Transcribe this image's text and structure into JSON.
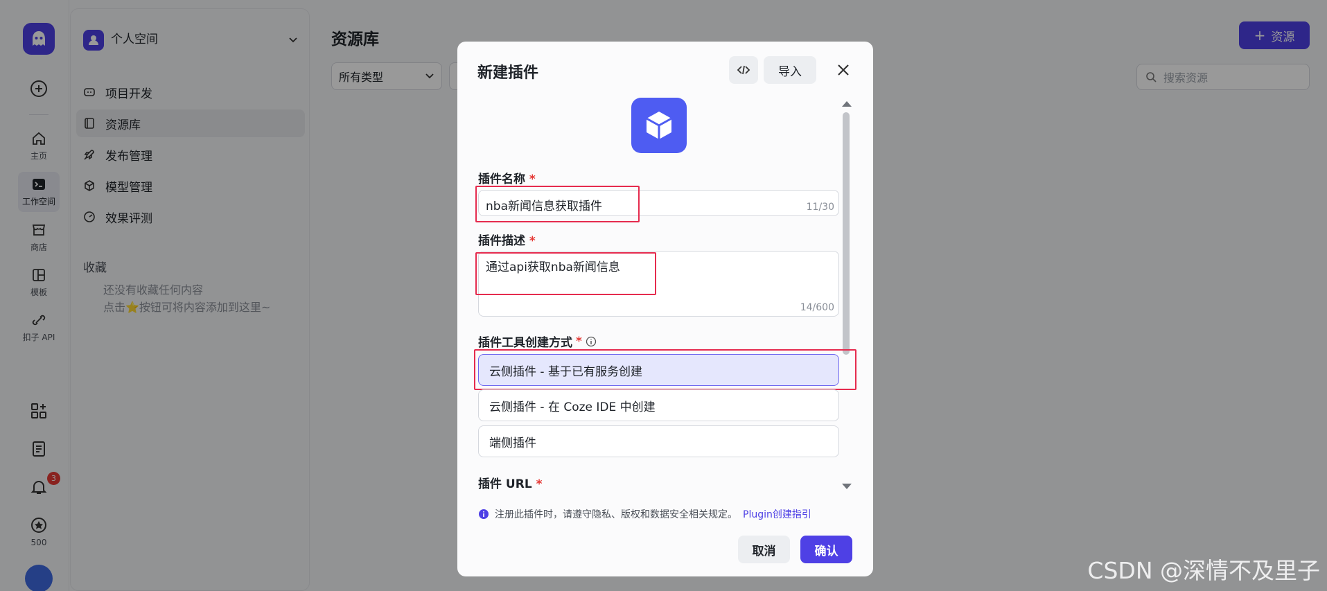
{
  "rail": {
    "items": [
      {
        "label": "主页",
        "icon": "home-icon"
      },
      {
        "label": "工作空间",
        "icon": "terminal-icon"
      },
      {
        "label": "商店",
        "icon": "store-icon"
      },
      {
        "label": "模板",
        "icon": "template-icon"
      },
      {
        "label": "扣子 API",
        "icon": "api-icon"
      }
    ],
    "coin_count": "500",
    "notification_count": "3"
  },
  "nav": {
    "workspace": "个人空间",
    "items": [
      {
        "label": "项目开发",
        "icon": "project-icon"
      },
      {
        "label": "资源库",
        "icon": "library-icon"
      },
      {
        "label": "发布管理",
        "icon": "rocket-icon"
      },
      {
        "label": "模型管理",
        "icon": "model-icon"
      },
      {
        "label": "效果评测",
        "icon": "gauge-icon"
      }
    ],
    "favorites_title": "收藏",
    "favorites_empty_1": "还没有收藏任何内容",
    "favorites_empty_2": "点击⭐按钮可将内容添加到这里~"
  },
  "main": {
    "title": "资源库",
    "type_filter": "所有类型",
    "search_placeholder": "搜索资源",
    "add_resource": "资源"
  },
  "modal": {
    "title": "新建插件",
    "import_label": "导入",
    "name_label": "插件名称",
    "name_value": "nba新闻信息获取插件",
    "name_counter": "11/30",
    "desc_label": "插件描述",
    "desc_value": "通过api获取nba新闻信息",
    "desc_counter": "14/600",
    "method_label": "插件工具创建方式",
    "options": [
      "云侧插件 - 基于已有服务创建",
      "云侧插件 - 在 Coze IDE 中创建",
      "端侧插件"
    ],
    "url_label": "插件 URL",
    "note": "注册此插件时，请遵守隐私、版权和数据安全相关规定。",
    "note_link": "Plugin创建指引",
    "cancel": "取消",
    "confirm": "确认"
  },
  "watermark": "CSDN @深情不及里子",
  "colors": {
    "accent": "#4e40e5",
    "highlight": "#e52b4e"
  }
}
